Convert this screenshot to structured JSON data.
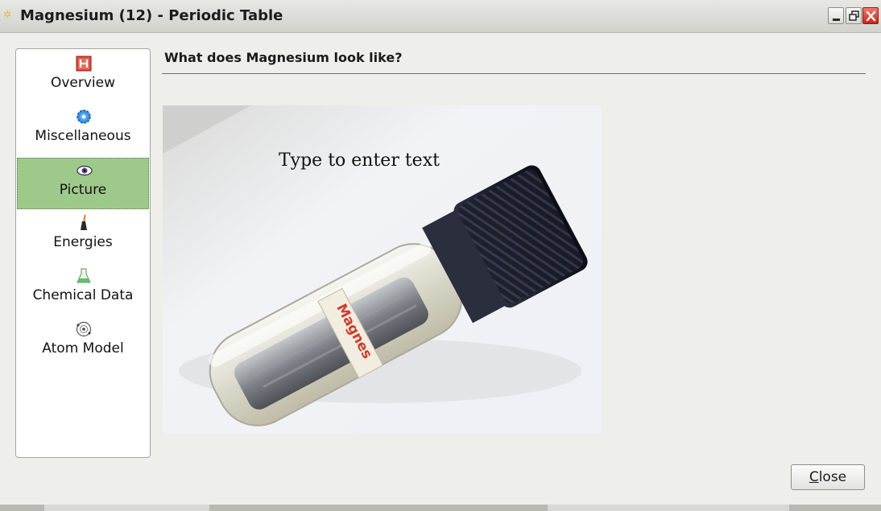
{
  "window": {
    "title": "Magnesium (12) - Periodic Table",
    "title_icon": "app-icon",
    "controls": [
      "minimize-icon",
      "maximize-icon",
      "close-icon"
    ]
  },
  "sidebar": {
    "items": [
      {
        "label": "Overview",
        "icon": "h-element-icon",
        "selected": false
      },
      {
        "label": "Miscellaneous",
        "icon": "gear-icon",
        "selected": false
      },
      {
        "label": "Picture",
        "icon": "eye-icon",
        "selected": true
      },
      {
        "label": "Energies",
        "icon": "flask-burner-icon",
        "selected": false
      },
      {
        "label": "Chemical Data",
        "icon": "flask-icon",
        "selected": false
      },
      {
        "label": "Atom Model",
        "icon": "atom-icon",
        "selected": false
      }
    ]
  },
  "main": {
    "heading": "What does Magnesium look like?",
    "picture": {
      "overlay_text": "Type to enter text",
      "label_text": "Magnes"
    }
  },
  "footer": {
    "close_button": {
      "mnemonic": "C",
      "rest": "lose"
    }
  },
  "colors": {
    "selected_bg": "#9dc98a",
    "window_bg": "#eeeeea",
    "close_control": "#d03a2c"
  }
}
